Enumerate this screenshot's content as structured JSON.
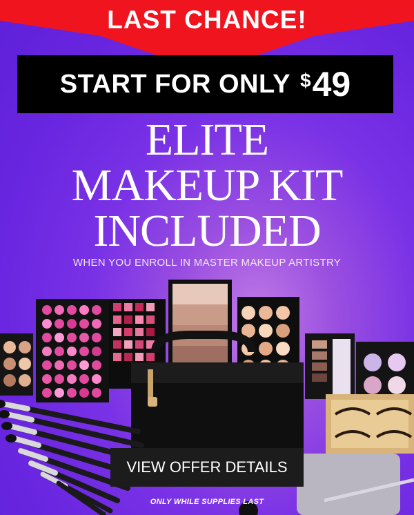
{
  "banner": {
    "text": "LAST CHANCE!"
  },
  "price": {
    "lead": "START FOR ONLY",
    "currency": "$",
    "amount": "49"
  },
  "headline": {
    "line1": "ELITE",
    "line2": "MAKEUP KIT",
    "line3": "INCLUDED"
  },
  "subline": "WHEN YOU ENROLL IN  MASTER MAKEUP ARTISTRY",
  "cta": {
    "label": "VIEW OFFER DETAILS"
  },
  "footnote": "ONLY WHILE SUPPLIES LAST",
  "colors": {
    "banner_red": "#f0141e",
    "price_bar": "#000000",
    "background_purple": "#6a26e0",
    "cta_bg": "#1c1c1c"
  },
  "images": {
    "product_scene": "makeup-kit-photo"
  }
}
